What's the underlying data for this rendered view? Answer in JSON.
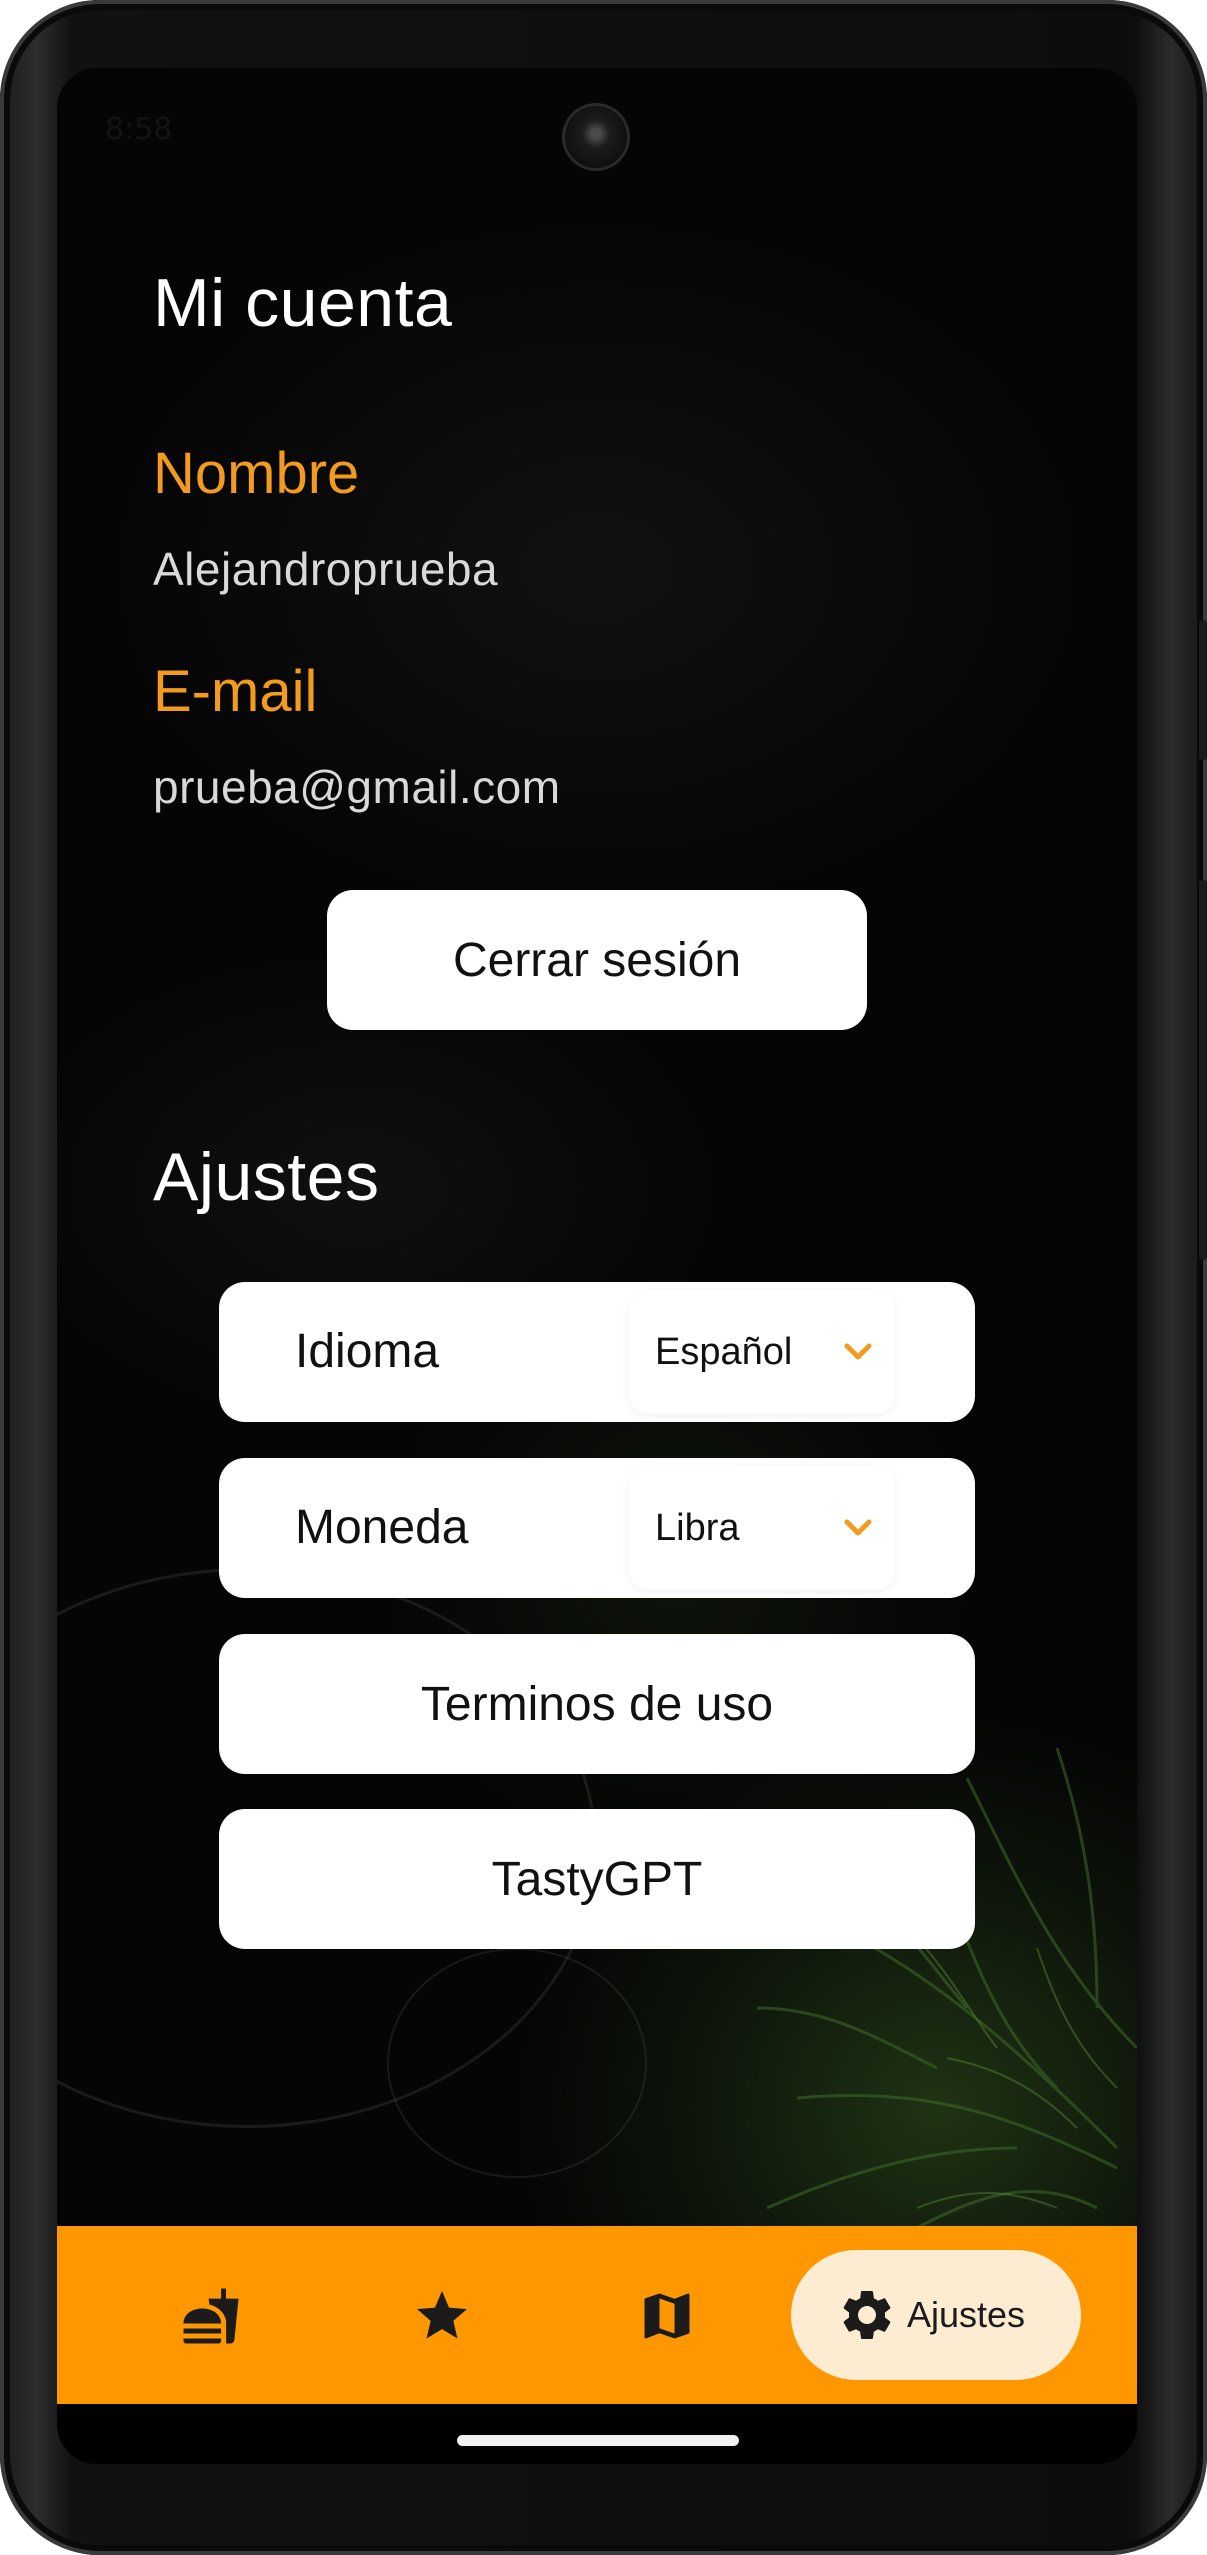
{
  "status_bar": {
    "time": "8:58"
  },
  "account": {
    "title": "Mi cuenta",
    "name_label": "Nombre",
    "name_value": "Alejandroprueba",
    "email_label": "E-mail",
    "email_value": "prueba@gmail.com",
    "logout_label": "Cerrar sesión"
  },
  "settings": {
    "title": "Ajustes",
    "language": {
      "label": "Idioma",
      "selected": "Español"
    },
    "currency": {
      "label": "Moneda",
      "selected": "Libra"
    },
    "terms_label": "Terminos de uso",
    "tastygpt_label": "TastyGPT"
  },
  "bottom_nav": {
    "items": [
      {
        "icon": "fastfood-icon",
        "label": ""
      },
      {
        "icon": "star-icon",
        "label": ""
      },
      {
        "icon": "map-icon",
        "label": ""
      },
      {
        "icon": "gear-icon",
        "label": "Ajustes",
        "active": true
      }
    ]
  },
  "colors": {
    "accent": "#ff9800",
    "label_orange": "#f29b1f",
    "active_pill": "#fdebd2",
    "background": "#050505"
  }
}
